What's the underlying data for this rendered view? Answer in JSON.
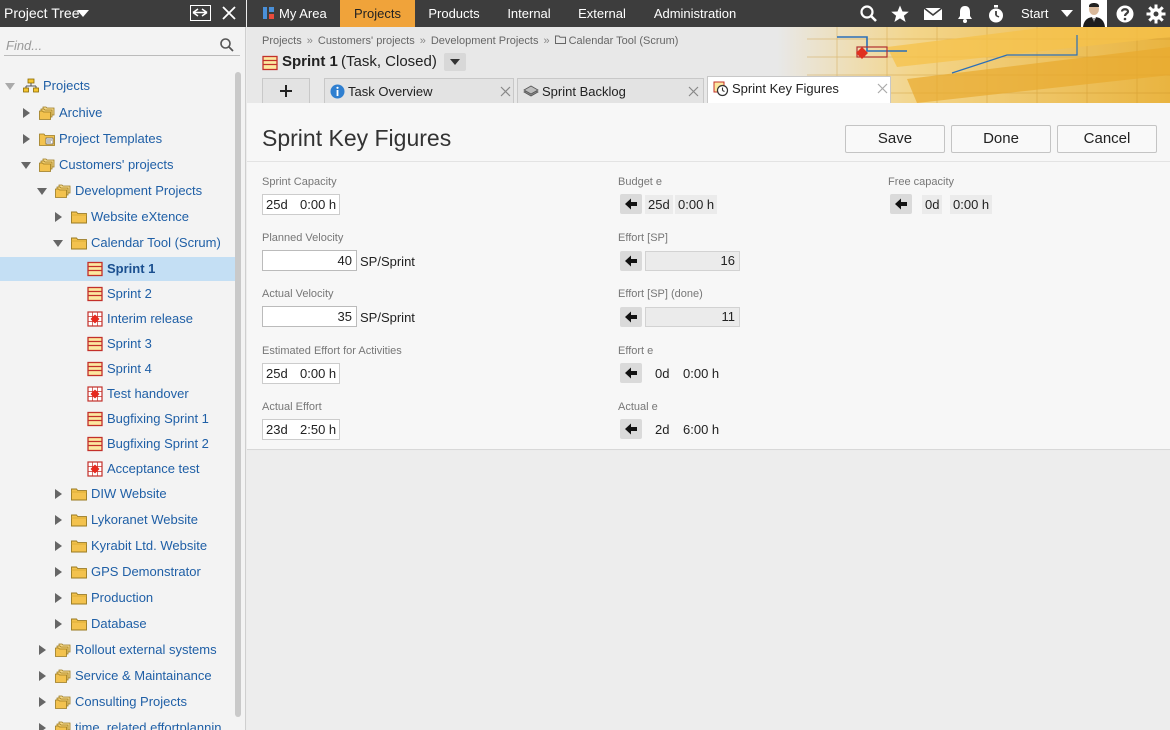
{
  "sidebar": {
    "title": "Project Tree",
    "search_placeholder": "Find...",
    "tree": [
      {
        "label": "Projects",
        "indent": 0,
        "arrow": "expanded-grey",
        "icon": "projects-root-icon"
      },
      {
        "label": "Archive",
        "indent": 1,
        "arrow": "collapsed",
        "icon": "folder-stack-icon"
      },
      {
        "label": "Project Templates",
        "indent": 1,
        "arrow": "collapsed",
        "icon": "template-folder-icon"
      },
      {
        "label": "Customers' projects",
        "indent": 1,
        "arrow": "expanded",
        "icon": "folder-stack-icon"
      },
      {
        "label": "Development Projects",
        "indent": 2,
        "arrow": "expanded",
        "icon": "folder-stack-icon"
      },
      {
        "label": "Website eXtence",
        "indent": 3,
        "arrow": "collapsed",
        "icon": "folder-icon"
      },
      {
        "label": "Calendar Tool (Scrum)",
        "indent": 3,
        "arrow": "expanded",
        "icon": "folder-icon"
      },
      {
        "label": "Sprint 1",
        "indent": 4,
        "arrow": "none",
        "icon": "sprint-icon",
        "selected": true
      },
      {
        "label": "Sprint 2",
        "indent": 4,
        "arrow": "none",
        "icon": "sprint-icon"
      },
      {
        "label": "Interim release",
        "indent": 4,
        "arrow": "none",
        "icon": "milestone-icon"
      },
      {
        "label": "Sprint 3",
        "indent": 4,
        "arrow": "none",
        "icon": "sprint-icon"
      },
      {
        "label": "Sprint 4",
        "indent": 4,
        "arrow": "none",
        "icon": "sprint-icon"
      },
      {
        "label": "Test handover",
        "indent": 4,
        "arrow": "none",
        "icon": "milestone-icon"
      },
      {
        "label": "Bugfixing Sprint 1",
        "indent": 4,
        "arrow": "none",
        "icon": "sprint-icon"
      },
      {
        "label": "Bugfixing Sprint 2",
        "indent": 4,
        "arrow": "none",
        "icon": "sprint-icon"
      },
      {
        "label": "Acceptance test",
        "indent": 4,
        "arrow": "none",
        "icon": "milestone-icon"
      },
      {
        "label": "DIW Website",
        "indent": 3,
        "arrow": "collapsed",
        "icon": "folder-icon"
      },
      {
        "label": "Lykoranet Website",
        "indent": 3,
        "arrow": "collapsed",
        "icon": "folder-icon"
      },
      {
        "label": "Kyrabit Ltd. Website",
        "indent": 3,
        "arrow": "collapsed",
        "icon": "folder-icon"
      },
      {
        "label": "GPS Demonstrator",
        "indent": 3,
        "arrow": "collapsed",
        "icon": "folder-icon"
      },
      {
        "label": "Production",
        "indent": 3,
        "arrow": "collapsed",
        "icon": "folder-icon"
      },
      {
        "label": "Database",
        "indent": 3,
        "arrow": "collapsed",
        "icon": "folder-icon"
      },
      {
        "label": "Rollout external systems",
        "indent": 2,
        "arrow": "collapsed",
        "icon": "folder-stack-icon"
      },
      {
        "label": "Service & Maintainance",
        "indent": 2,
        "arrow": "collapsed",
        "icon": "folder-stack-icon"
      },
      {
        "label": "Consulting Projects",
        "indent": 2,
        "arrow": "collapsed",
        "icon": "folder-stack-icon"
      },
      {
        "label": "time_related effortplannin",
        "indent": 2,
        "arrow": "collapsed",
        "icon": "folder-stack-icon"
      }
    ]
  },
  "topnav": {
    "items": [
      {
        "label": "My Area",
        "active": false
      },
      {
        "label": "Projects",
        "active": true
      },
      {
        "label": "Products",
        "active": false
      },
      {
        "label": "Internal",
        "active": false
      },
      {
        "label": "External",
        "active": false
      },
      {
        "label": "Administration",
        "active": false
      }
    ],
    "start_label": "Start",
    "icons": [
      "search-icon",
      "star-icon",
      "mail-icon",
      "bell-icon",
      "stopwatch-icon",
      "help-icon",
      "gear-icon"
    ]
  },
  "breadcrumb": [
    "Projects",
    "Customers' projects",
    "Development Projects",
    "Calendar Tool (Scrum)"
  ],
  "task": {
    "name": "Sprint 1",
    "status": "(Task, Closed)"
  },
  "tabs": [
    {
      "label": "Task Overview",
      "icon": "info-icon",
      "active": false
    },
    {
      "label": "Sprint Backlog",
      "icon": "backlog-icon",
      "active": false
    },
    {
      "label": "Sprint Key Figures",
      "icon": "key-figures-icon",
      "active": true
    }
  ],
  "page": {
    "title": "Sprint Key Figures",
    "buttons": {
      "save": "Save",
      "done": "Done",
      "cancel": "Cancel"
    }
  },
  "fields": {
    "sprint_capacity": {
      "label": "Sprint Capacity",
      "days": "25d",
      "time": "0:00 h"
    },
    "planned_velocity": {
      "label": "Planned Velocity",
      "value": "40",
      "unit": "SP/Sprint"
    },
    "actual_velocity": {
      "label": "Actual Velocity",
      "value": "35",
      "unit": "SP/Sprint"
    },
    "estimated_effort": {
      "label": "Estimated Effort for Activities",
      "days": "25d",
      "time": "0:00 h"
    },
    "actual_effort": {
      "label": "Actual Effort",
      "days": "23d",
      "time": "2:50 h"
    },
    "budget": {
      "label": "Budget e",
      "days": "25d",
      "time": "0:00 h"
    },
    "effort_sp": {
      "label": "Effort [SP]",
      "value": "16"
    },
    "effort_sp_done": {
      "label": "Effort [SP] (done)",
      "value": "11"
    },
    "effort_e": {
      "label": "Effort e",
      "days": "0d",
      "time": "0:00 h"
    },
    "actual_e": {
      "label": "Actual e",
      "days": "2d",
      "time": "6:00 h"
    },
    "free_capacity": {
      "label": "Free capacity",
      "days": "0d",
      "time": "0:00 h"
    }
  },
  "colors": {
    "nav_bg": "#3d3d3d",
    "accent": "#f0a33a",
    "link": "#1f5fa6",
    "selected_row": "#c4dff4"
  }
}
